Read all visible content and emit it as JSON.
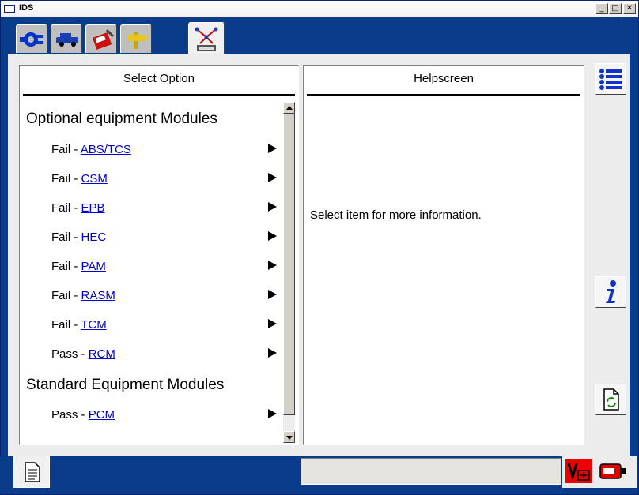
{
  "window": {
    "title": "IDS",
    "minimize_label": "_",
    "maximize_label": "□",
    "close_label": "✕"
  },
  "tabs": [
    {
      "icon": "connector-icon"
    },
    {
      "icon": "vehicle-icon"
    },
    {
      "icon": "toolbox-icon"
    },
    {
      "icon": "direction-sign-icon"
    },
    {
      "icon": "network-test-icon",
      "active": true
    }
  ],
  "left_panel": {
    "header": "Select Option",
    "groups": [
      {
        "heading": "Optional equipment Modules",
        "items": [
          {
            "status": "Fail - ",
            "module": "ABS/TCS"
          },
          {
            "status": "Fail - ",
            "module": "CSM"
          },
          {
            "status": "Fail - ",
            "module": "EPB"
          },
          {
            "status": "Fail - ",
            "module": "HEC"
          },
          {
            "status": "Fail - ",
            "module": "PAM"
          },
          {
            "status": "Fail - ",
            "module": "RASM"
          },
          {
            "status": "Fail - ",
            "module": "TCM"
          },
          {
            "status": "Pass - ",
            "module": "RCM"
          }
        ]
      },
      {
        "heading": "Standard Equipment Modules",
        "items": [
          {
            "status": "Pass - ",
            "module": "PCM"
          }
        ]
      }
    ]
  },
  "right_panel": {
    "header": "Helpscreen",
    "message": "Select item for more information."
  },
  "side_buttons": [
    {
      "icon": "list-icon"
    },
    {
      "icon": "info-icon"
    },
    {
      "icon": "refresh-document-icon"
    }
  ],
  "bottom": {
    "tab_icon": "document-icon",
    "status_text": "",
    "indicators": [
      {
        "icon": "vehicle-battery-icon"
      },
      {
        "icon": "vcm-connection-icon"
      }
    ]
  },
  "colors": {
    "accent_blue": "#0a3c8c",
    "link": "#0000cc",
    "panel_bg": "#ececec"
  }
}
